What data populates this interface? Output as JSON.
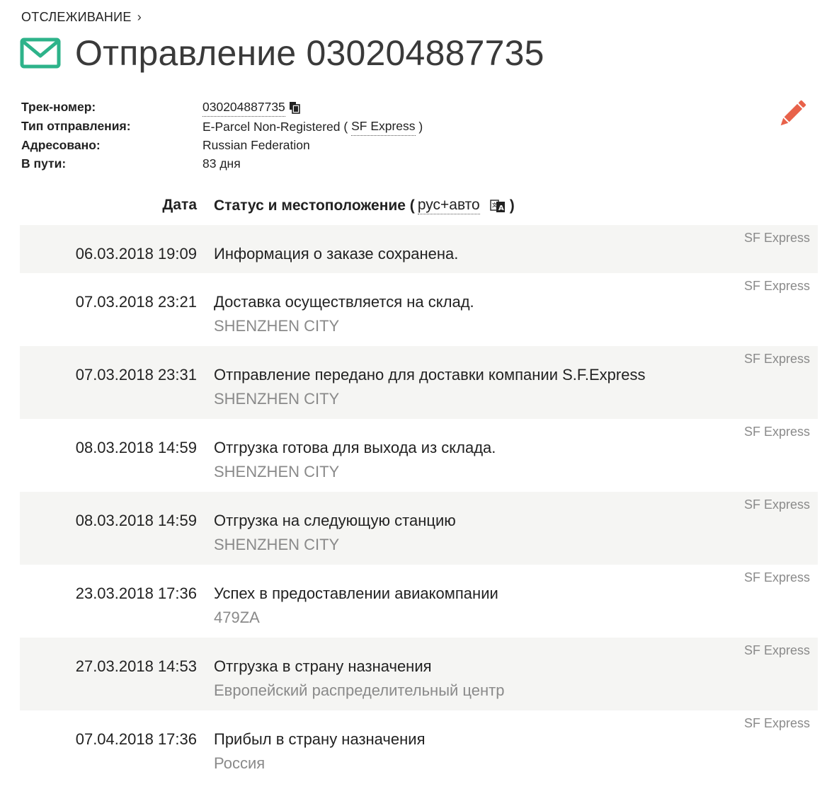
{
  "breadcrumb": {
    "label": "ОТСЛЕЖИВАНИЕ",
    "chevron": "›"
  },
  "header": {
    "icon": "envelope-icon",
    "title": "Отправление 030204887735",
    "accent": "#2db38a"
  },
  "info": {
    "track_label": "Трек-номер:",
    "track_value": "030204887735",
    "type_label": "Тип отправления:",
    "type_value_prefix": "E-Parcel Non-Registered (",
    "type_carrier": "SF Express",
    "type_value_suffix": ")",
    "address_label": "Адресовано:",
    "address_value": "Russian Federation",
    "transit_label": "В пути:",
    "transit_value": "83 дня"
  },
  "edit": {
    "icon": "pencil-icon",
    "color": "#e8624a"
  },
  "table": {
    "date_header": "Дата",
    "status_header": "Статус и местоположение (",
    "lang_link": "рус+авто",
    "close_paren": ")",
    "events": [
      {
        "date": "06.03.2018 19:09",
        "status": "Информация о заказе сохранена.",
        "location": "",
        "carrier": "SF Express"
      },
      {
        "date": "07.03.2018 23:21",
        "status": "Доставка осуществляется на склад.",
        "location": "SHENZHEN CITY",
        "carrier": "SF Express"
      },
      {
        "date": "07.03.2018 23:31",
        "status": "Отправление передано для доставки компании S.F.Express",
        "location": "SHENZHEN CITY",
        "carrier": "SF Express"
      },
      {
        "date": "08.03.2018 14:59",
        "status": "Отгрузка готова для выхода из склада.",
        "location": "SHENZHEN CITY",
        "carrier": "SF Express"
      },
      {
        "date": "08.03.2018 14:59",
        "status": "Отгрузка на следующую станцию",
        "location": "SHENZHEN CITY",
        "carrier": "SF Express"
      },
      {
        "date": "23.03.2018 17:36",
        "status": "Успех в предоставлении авиакомпании",
        "location": "479ZA",
        "carrier": "SF Express"
      },
      {
        "date": "27.03.2018 14:53",
        "status": "Отгрузка в страну назначения",
        "location": "Европейский распределительный центр",
        "carrier": "SF Express"
      },
      {
        "date": "07.04.2018 17:36",
        "status": "Прибыл в страну назначения",
        "location": "Россия",
        "carrier": "SF Express"
      }
    ]
  }
}
